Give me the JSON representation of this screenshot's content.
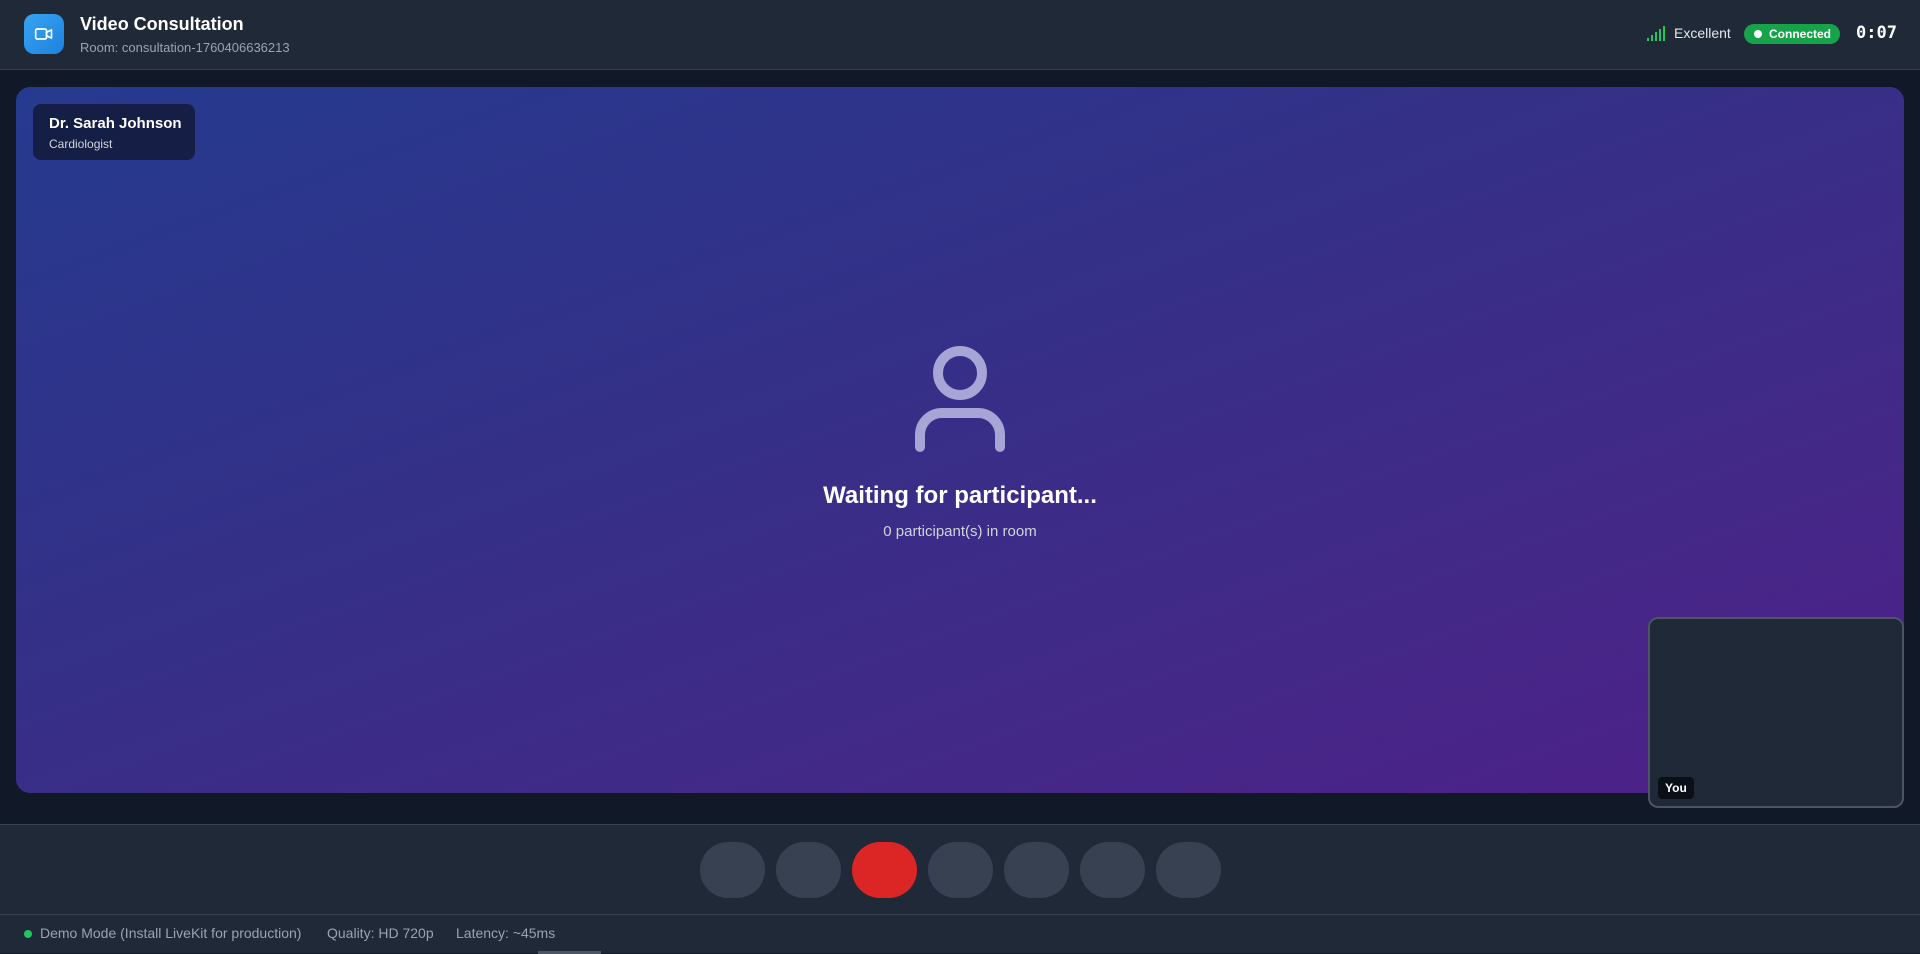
{
  "header": {
    "app_icon": "video-camera-icon",
    "title": "Video Consultation",
    "room": "Room: consultation-1760406636213",
    "signal_icon": "signal-bars-icon",
    "connection_quality": "Excellent",
    "status": "Connected",
    "timer": "0:07"
  },
  "remote": {
    "name": "Dr. Sarah Johnson",
    "role": "Cardiologist",
    "placeholder_icon": "user-icon",
    "waiting_title": "Waiting for participant...",
    "participants_text": "0 participant(s) in room"
  },
  "self_view": {
    "label": "You"
  },
  "controls": [
    {
      "name": "control-button-1"
    },
    {
      "name": "control-button-2"
    },
    {
      "name": "end-call-button",
      "color": "#dc2626"
    },
    {
      "name": "control-button-4"
    },
    {
      "name": "control-button-5"
    },
    {
      "name": "control-button-6"
    },
    {
      "name": "control-button-7"
    }
  ],
  "statusbar": {
    "mode": "Demo Mode (Install LiveKit for production)",
    "quality": "Quality: HD 720p",
    "latency": "Latency: ~45ms"
  },
  "colors": {
    "accent": "#1d82e0",
    "connected": "#16a34a",
    "end_call": "#dc2626",
    "signal": "#22c55e"
  }
}
